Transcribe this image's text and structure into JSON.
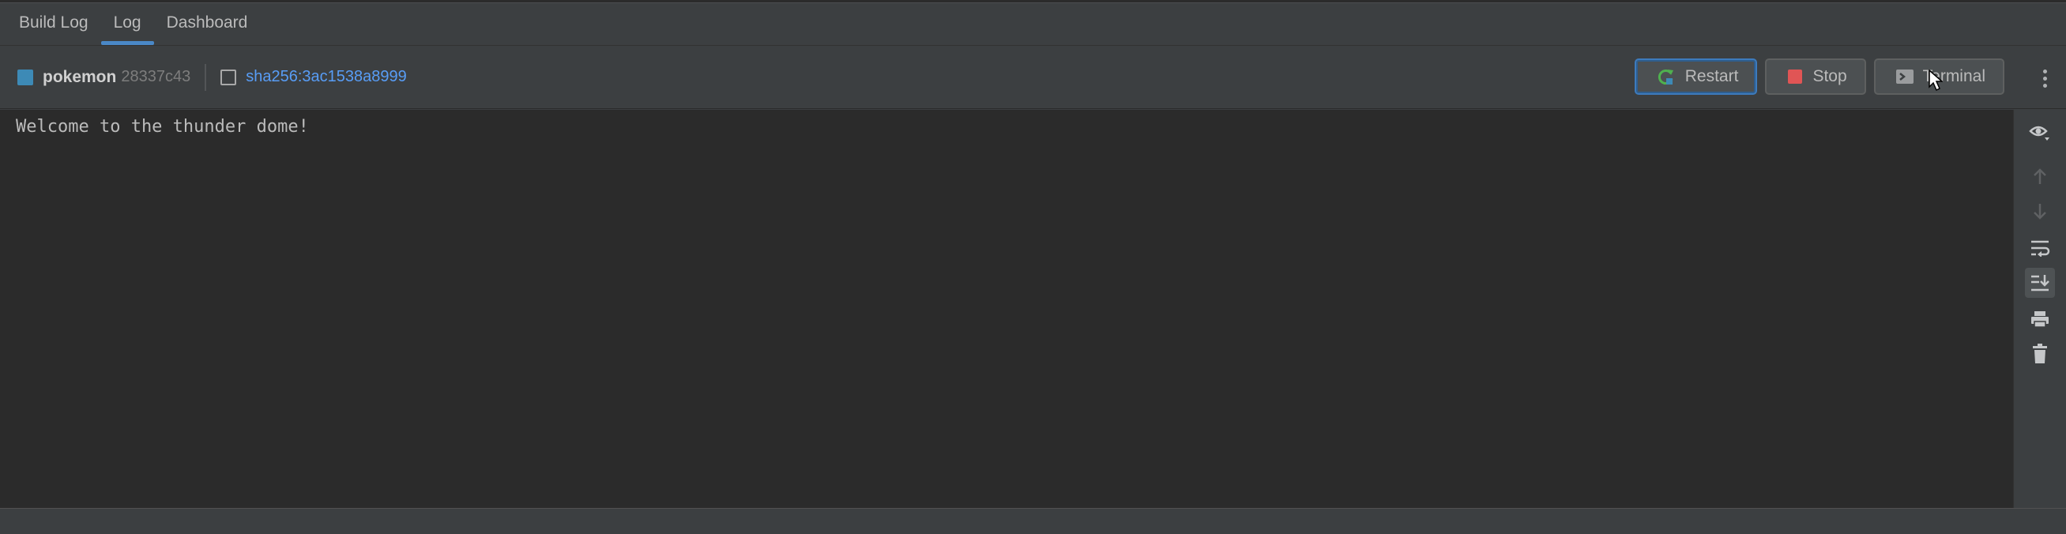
{
  "tabs": [
    {
      "label": "Build Log",
      "active": false
    },
    {
      "label": "Log",
      "active": true
    },
    {
      "label": "Dashboard",
      "active": false
    }
  ],
  "container": {
    "name": "pokemon",
    "id": "28337c43",
    "status_color": "#3d8ab6",
    "image": "sha256:3ac1538a8999"
  },
  "buttons": {
    "restart": "Restart",
    "stop": "Stop",
    "terminal": "Terminal"
  },
  "log": {
    "lines": [
      "Welcome to the thunder dome!"
    ]
  },
  "side_tools": [
    "eye-icon",
    "arrow-up-icon",
    "arrow-down-icon",
    "soft-wrap-icon",
    "scroll-to-end-icon",
    "print-icon",
    "trash-icon"
  ],
  "colors": {
    "accent": "#4a88c7",
    "link": "#589df6",
    "stop_red": "#e05555",
    "restart_green": "#4fb14f"
  }
}
